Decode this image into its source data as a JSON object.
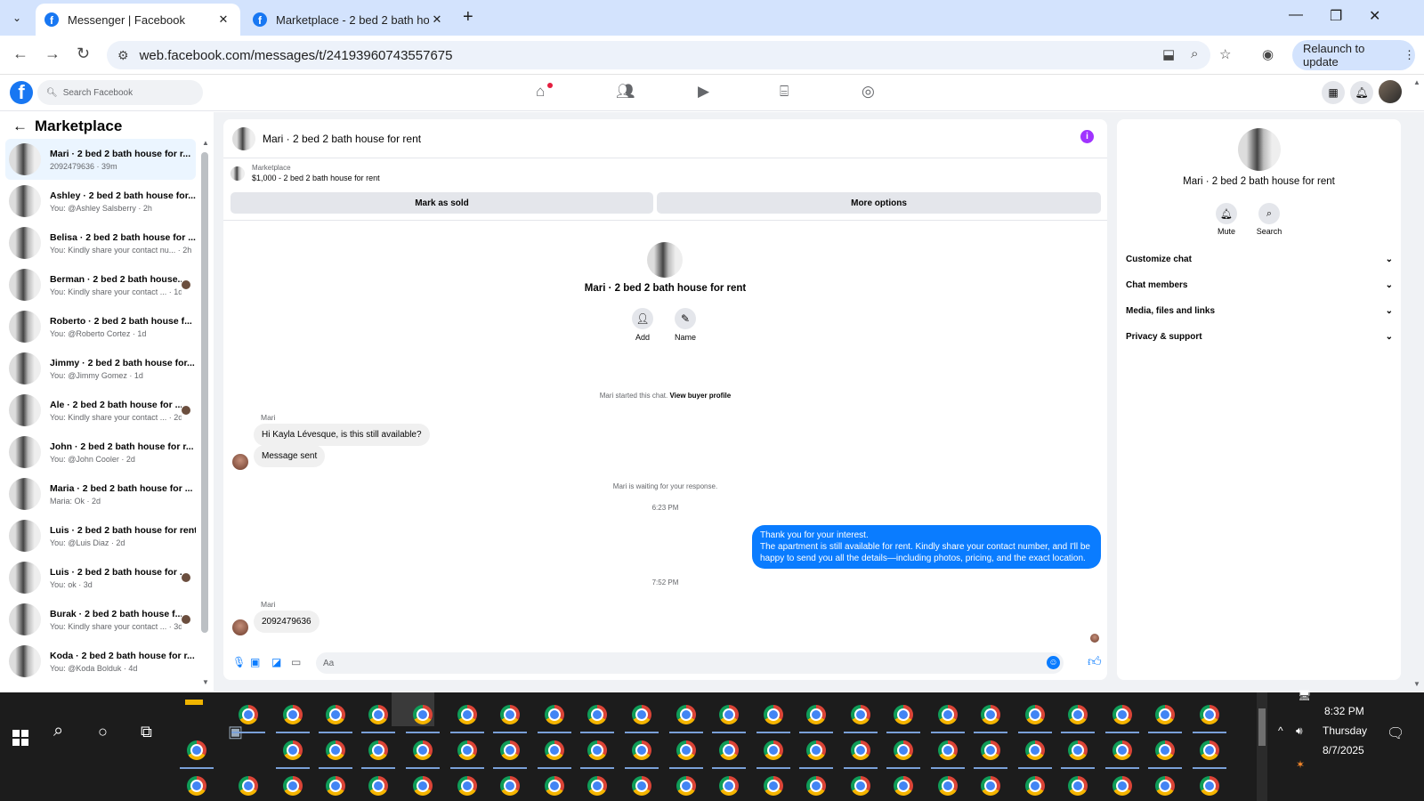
{
  "browser": {
    "tabs": [
      {
        "title": "Messenger | Facebook",
        "active": true
      },
      {
        "title": "Marketplace - 2 bed 2 bath hou",
        "active": false
      }
    ],
    "url": "web.facebook.com/messages/t/24193960743557675",
    "relaunch_label": "Relaunch to update"
  },
  "fb": {
    "search_placeholder": "Search Facebook",
    "nav_icons": [
      "home-icon",
      "friends-icon",
      "video-icon",
      "marketplace-icon",
      "groups-icon"
    ]
  },
  "sidebar": {
    "title": "Marketplace",
    "conversations": [
      {
        "name": "Mari · 2 bed 2 bath house for r...",
        "sub": "2092479636 · 39m",
        "selected": true
      },
      {
        "name": "Ashley · 2 bed 2 bath house for...",
        "sub": "You: @Ashley Salsberry · 2h"
      },
      {
        "name": "Belisa · 2 bed 2 bath house for ...",
        "sub": "You: Kindly share your contact nu... · 2h"
      },
      {
        "name": "Berman · 2 bed 2 bath house...",
        "sub": "You: Kindly share your contact ... · 1d"
      },
      {
        "name": "Roberto · 2 bed 2 bath house f...",
        "sub": "You: @Roberto Cortez · 1d"
      },
      {
        "name": "Jimmy · 2 bed 2 bath house for...",
        "sub": "You: @Jimmy Gomez · 1d"
      },
      {
        "name": "Ale · 2 bed 2 bath house for ...",
        "sub": "You: Kindly share your contact ... · 2d"
      },
      {
        "name": "John · 2 bed 2 bath house for r...",
        "sub": "You: @John Cooler · 2d"
      },
      {
        "name": "Maria · 2 bed 2 bath house for ...",
        "sub": "Maria: Ok · 2d"
      },
      {
        "name": "Luis · 2 bed 2 bath house for rent",
        "sub": "You: @Luis Diaz · 2d"
      },
      {
        "name": "Luis · 2 bed 2 bath house for ...",
        "sub": "You: ok · 3d"
      },
      {
        "name": "Burak · 2 bed 2 bath house f...",
        "sub": "You: Kindly share your contact ... · 3d"
      },
      {
        "name": "Koda · 2 bed 2 bath house for r...",
        "sub": "You: @Koda Bolduk · 4d"
      }
    ]
  },
  "chat": {
    "title": "Mari · 2 bed 2 bath house for rent",
    "listing_source": "Marketplace",
    "listing": "$1,000 - 2 bed 2 bath house for rent",
    "mark_sold": "Mark as sold",
    "more_options": "More options",
    "contact_name": "Mari · 2 bed 2 bath house for rent",
    "add_label": "Add",
    "name_label": "Name",
    "started_text": "Mari started this chat.",
    "view_profile": "View buyer profile",
    "sender": "Mari",
    "msg1": "Hi Kayla Lévesque, is this still available?",
    "msg2": "Message sent",
    "waiting": "Mari is waiting for your response.",
    "time1": "6:23 PM",
    "reply_line1": "Thank you for your interest.",
    "reply_line2": "The apartment is still available for rent. Kindly share your contact number, and I'll be happy to send you all the details—including photos, pricing, and the exact location.",
    "time2": "7:52 PM",
    "msg3": "2092479636",
    "composer_placeholder": "Aa"
  },
  "details": {
    "name": "Mari · 2 bed 2 bath house for rent",
    "mute": "Mute",
    "search": "Search",
    "sections": [
      "Customize chat",
      "Chat members",
      "Media, files and links",
      "Privacy & support"
    ]
  },
  "taskbar": {
    "time": "8:32 PM",
    "day": "Thursday",
    "date": "8/7/2025"
  }
}
